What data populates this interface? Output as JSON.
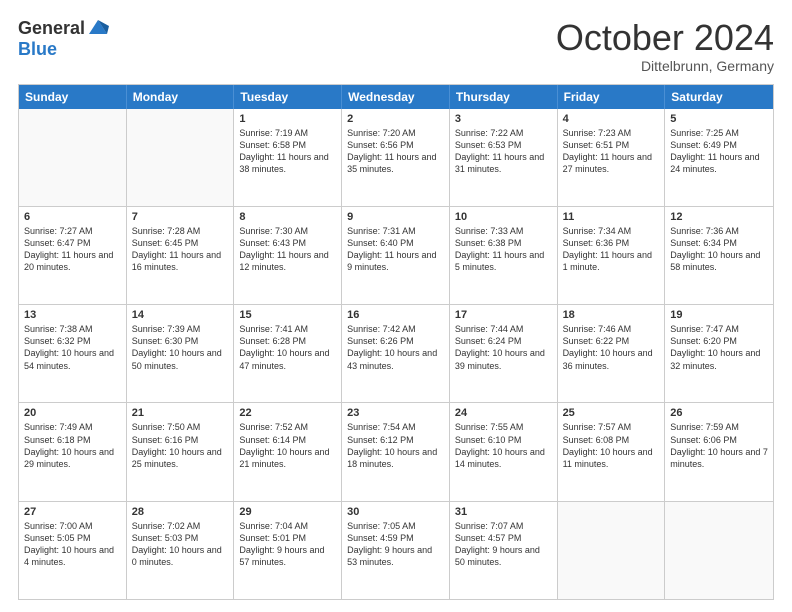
{
  "header": {
    "logo_line1": "General",
    "logo_line2": "Blue",
    "month": "October 2024",
    "location": "Dittelbrunn, Germany"
  },
  "weekdays": [
    "Sunday",
    "Monday",
    "Tuesday",
    "Wednesday",
    "Thursday",
    "Friday",
    "Saturday"
  ],
  "rows": [
    [
      {
        "day": "",
        "text": ""
      },
      {
        "day": "",
        "text": ""
      },
      {
        "day": "1",
        "text": "Sunrise: 7:19 AM\nSunset: 6:58 PM\nDaylight: 11 hours and 38 minutes."
      },
      {
        "day": "2",
        "text": "Sunrise: 7:20 AM\nSunset: 6:56 PM\nDaylight: 11 hours and 35 minutes."
      },
      {
        "day": "3",
        "text": "Sunrise: 7:22 AM\nSunset: 6:53 PM\nDaylight: 11 hours and 31 minutes."
      },
      {
        "day": "4",
        "text": "Sunrise: 7:23 AM\nSunset: 6:51 PM\nDaylight: 11 hours and 27 minutes."
      },
      {
        "day": "5",
        "text": "Sunrise: 7:25 AM\nSunset: 6:49 PM\nDaylight: 11 hours and 24 minutes."
      }
    ],
    [
      {
        "day": "6",
        "text": "Sunrise: 7:27 AM\nSunset: 6:47 PM\nDaylight: 11 hours and 20 minutes."
      },
      {
        "day": "7",
        "text": "Sunrise: 7:28 AM\nSunset: 6:45 PM\nDaylight: 11 hours and 16 minutes."
      },
      {
        "day": "8",
        "text": "Sunrise: 7:30 AM\nSunset: 6:43 PM\nDaylight: 11 hours and 12 minutes."
      },
      {
        "day": "9",
        "text": "Sunrise: 7:31 AM\nSunset: 6:40 PM\nDaylight: 11 hours and 9 minutes."
      },
      {
        "day": "10",
        "text": "Sunrise: 7:33 AM\nSunset: 6:38 PM\nDaylight: 11 hours and 5 minutes."
      },
      {
        "day": "11",
        "text": "Sunrise: 7:34 AM\nSunset: 6:36 PM\nDaylight: 11 hours and 1 minute."
      },
      {
        "day": "12",
        "text": "Sunrise: 7:36 AM\nSunset: 6:34 PM\nDaylight: 10 hours and 58 minutes."
      }
    ],
    [
      {
        "day": "13",
        "text": "Sunrise: 7:38 AM\nSunset: 6:32 PM\nDaylight: 10 hours and 54 minutes."
      },
      {
        "day": "14",
        "text": "Sunrise: 7:39 AM\nSunset: 6:30 PM\nDaylight: 10 hours and 50 minutes."
      },
      {
        "day": "15",
        "text": "Sunrise: 7:41 AM\nSunset: 6:28 PM\nDaylight: 10 hours and 47 minutes."
      },
      {
        "day": "16",
        "text": "Sunrise: 7:42 AM\nSunset: 6:26 PM\nDaylight: 10 hours and 43 minutes."
      },
      {
        "day": "17",
        "text": "Sunrise: 7:44 AM\nSunset: 6:24 PM\nDaylight: 10 hours and 39 minutes."
      },
      {
        "day": "18",
        "text": "Sunrise: 7:46 AM\nSunset: 6:22 PM\nDaylight: 10 hours and 36 minutes."
      },
      {
        "day": "19",
        "text": "Sunrise: 7:47 AM\nSunset: 6:20 PM\nDaylight: 10 hours and 32 minutes."
      }
    ],
    [
      {
        "day": "20",
        "text": "Sunrise: 7:49 AM\nSunset: 6:18 PM\nDaylight: 10 hours and 29 minutes."
      },
      {
        "day": "21",
        "text": "Sunrise: 7:50 AM\nSunset: 6:16 PM\nDaylight: 10 hours and 25 minutes."
      },
      {
        "day": "22",
        "text": "Sunrise: 7:52 AM\nSunset: 6:14 PM\nDaylight: 10 hours and 21 minutes."
      },
      {
        "day": "23",
        "text": "Sunrise: 7:54 AM\nSunset: 6:12 PM\nDaylight: 10 hours and 18 minutes."
      },
      {
        "day": "24",
        "text": "Sunrise: 7:55 AM\nSunset: 6:10 PM\nDaylight: 10 hours and 14 minutes."
      },
      {
        "day": "25",
        "text": "Sunrise: 7:57 AM\nSunset: 6:08 PM\nDaylight: 10 hours and 11 minutes."
      },
      {
        "day": "26",
        "text": "Sunrise: 7:59 AM\nSunset: 6:06 PM\nDaylight: 10 hours and 7 minutes."
      }
    ],
    [
      {
        "day": "27",
        "text": "Sunrise: 7:00 AM\nSunset: 5:05 PM\nDaylight: 10 hours and 4 minutes."
      },
      {
        "day": "28",
        "text": "Sunrise: 7:02 AM\nSunset: 5:03 PM\nDaylight: 10 hours and 0 minutes."
      },
      {
        "day": "29",
        "text": "Sunrise: 7:04 AM\nSunset: 5:01 PM\nDaylight: 9 hours and 57 minutes."
      },
      {
        "day": "30",
        "text": "Sunrise: 7:05 AM\nSunset: 4:59 PM\nDaylight: 9 hours and 53 minutes."
      },
      {
        "day": "31",
        "text": "Sunrise: 7:07 AM\nSunset: 4:57 PM\nDaylight: 9 hours and 50 minutes."
      },
      {
        "day": "",
        "text": ""
      },
      {
        "day": "",
        "text": ""
      }
    ]
  ]
}
